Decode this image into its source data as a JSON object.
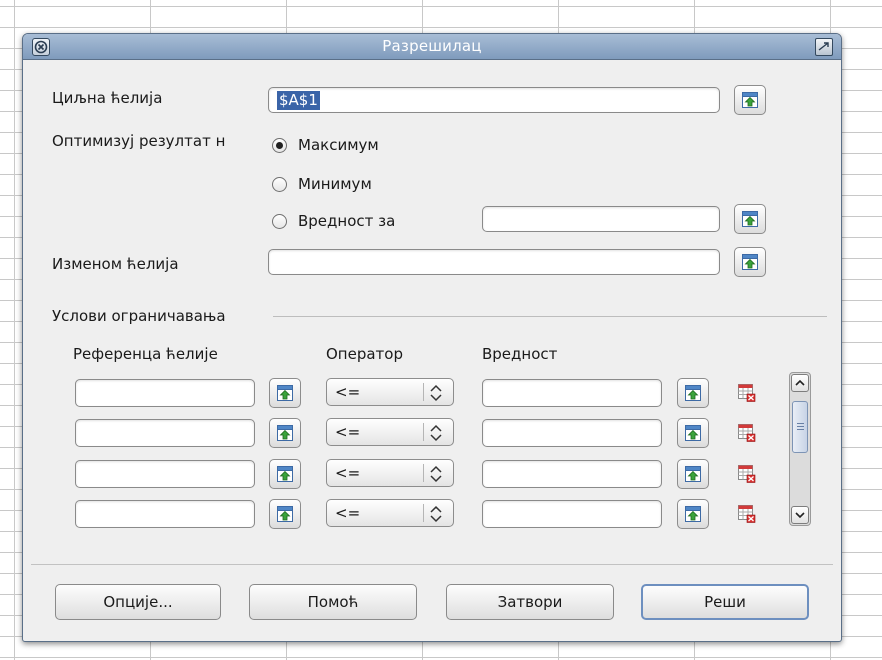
{
  "dialog": {
    "title": "Разрешилац"
  },
  "target_cell": {
    "label": "Циљна ћелија",
    "value": "$A$1"
  },
  "optimize": {
    "label": "Оптимизуј резултат н",
    "options": [
      {
        "label": "Максимум",
        "selected": true
      },
      {
        "label": "Минимум",
        "selected": false
      },
      {
        "label": "Вредност за",
        "selected": false
      }
    ],
    "value_for": ""
  },
  "changing_cells": {
    "label": "Изменом ћелија",
    "value": ""
  },
  "constraints": {
    "section_title": "Услови ограничавања",
    "headers": {
      "cell_ref": "Референца ћелије",
      "operator": "Оператор",
      "value": "Вредност"
    },
    "rows": [
      {
        "cell_ref": "",
        "operator": "<=",
        "value": ""
      },
      {
        "cell_ref": "",
        "operator": "<=",
        "value": ""
      },
      {
        "cell_ref": "",
        "operator": "<=",
        "value": ""
      },
      {
        "cell_ref": "",
        "operator": "<=",
        "value": ""
      }
    ]
  },
  "buttons": {
    "options": "Опције...",
    "help": "Помоћ",
    "close": "Затвори",
    "solve": "Реши"
  },
  "icons": {
    "shrink": "shrink-icon",
    "delete": "delete-row-icon",
    "scroll_up": "chevron-up-icon",
    "scroll_down": "chevron-down-icon",
    "spin": "spin-arrows-icon"
  }
}
